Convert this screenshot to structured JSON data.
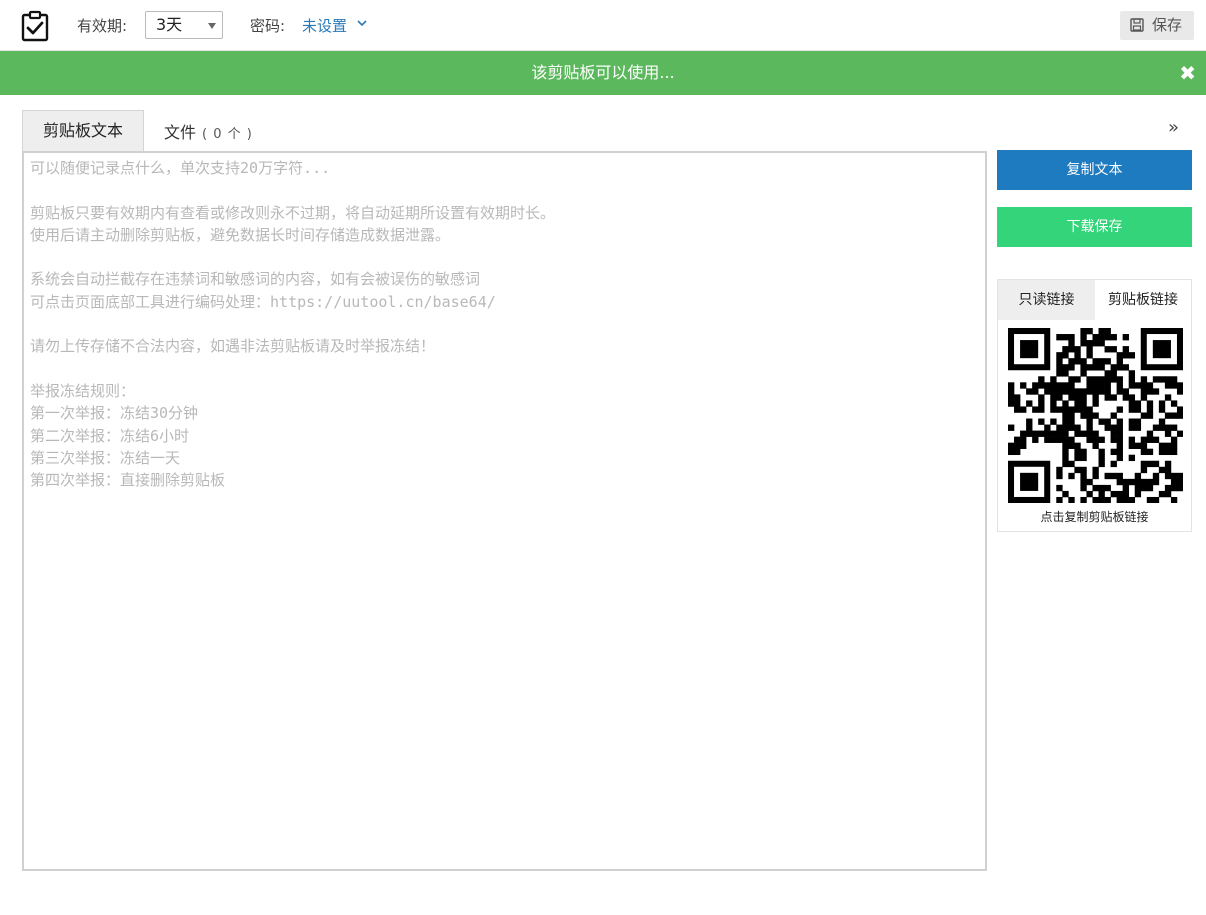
{
  "header": {
    "validity_label": "有效期:",
    "validity_value": "3天",
    "password_label": "密码:",
    "password_value": "未设置",
    "save_label": "保存"
  },
  "banner": {
    "message": "该剪贴板可以使用...",
    "close_glyph": "✖"
  },
  "tabs": {
    "text_tab": "剪贴板文本",
    "file_tab": "文件",
    "file_count": "( 0 个 )",
    "expand_glyph": "»"
  },
  "editor": {
    "placeholder": "可以随便记录点什么，单次支持20万字符...\n\n剪贴板只要有效期内有查看或修改则永不过期，将自动延期所设置有效期时长。\n使用后请主动删除剪贴板，避免数据长时间存储造成数据泄露。\n\n系统会自动拦截存在违禁词和敏感词的内容，如有会被误伤的敏感词\n可点击页面底部工具进行编码处理：https://uutool.cn/base64/\n\n请勿上传存储不合法内容，如遇非法剪贴板请及时举报冻结！\n\n举报冻结规则：\n第一次举报：冻结30分钟\n第二次举报：冻结6小时\n第三次举报：冻结一天\n第四次举报：直接删除剪贴板"
  },
  "sidebar": {
    "copy_text_button": "复制文本",
    "download_button": "下载保存",
    "link_tabs": [
      "只读链接",
      "剪贴板链接"
    ],
    "qr_caption": "点击复制剪贴板链接"
  },
  "colors": {
    "banner_green": "#5cb85c",
    "copy_blue": "#1f7bc0",
    "download_green": "#34d47a",
    "link_blue": "#2a7ab8"
  }
}
